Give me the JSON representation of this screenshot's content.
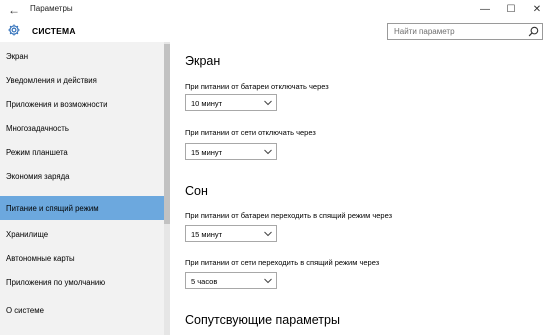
{
  "window": {
    "title": "Параметры",
    "back_glyph": "←",
    "min_glyph": "—",
    "max_glyph": "☐",
    "close_glyph": "✕"
  },
  "header": {
    "title": "СИСТЕМА",
    "icon": "gear-icon",
    "search_placeholder": "Найти параметр",
    "search_icon": "search-icon"
  },
  "sidebar": {
    "items": [
      {
        "label": "Экран",
        "active": false
      },
      {
        "label": "Уведомления и действия",
        "active": false
      },
      {
        "label": "Приложения и возможности",
        "active": false
      },
      {
        "label": "Многозадачность",
        "active": false
      },
      {
        "label": "Режим планшета",
        "active": false
      },
      {
        "label": "Экономия заряда",
        "active": false
      },
      {
        "label": "Питание и спящий режим",
        "active": true
      },
      {
        "label": "Хранилище",
        "active": false
      },
      {
        "label": "Автономные карты",
        "active": false
      },
      {
        "label": "Приложения по умолчанию",
        "active": false
      },
      {
        "label": "О системе",
        "active": false
      }
    ]
  },
  "main": {
    "screen_section": {
      "title": "Экран",
      "battery_label": "При питании от батареи отключать через",
      "battery_value": "10 минут",
      "plugged_label": "При питании от сети отключать через",
      "plugged_value": "15 минут"
    },
    "sleep_section": {
      "title": "Сон",
      "battery_label": "При питании от батареи переходить в спящий режим через",
      "battery_value": "15 минут",
      "plugged_label": "При питании от сети переходить в спящий режим через",
      "plugged_value": "5 часов"
    },
    "related_section": {
      "title": "Сопутсвующие параметры"
    }
  },
  "colors": {
    "accent": "#6ca8de",
    "sidebar_bg": "#f2f2f2",
    "gear": "#2f6fba"
  }
}
